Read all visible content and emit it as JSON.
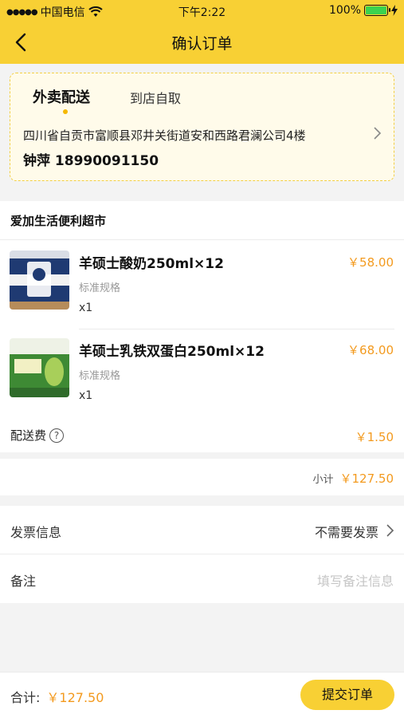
{
  "status_bar": {
    "carrier": "中国电信",
    "time": "下午2:22",
    "battery": "100%"
  },
  "nav": {
    "title": "确认订单"
  },
  "address": {
    "tab_active": "外卖配送",
    "tab_other": "到店自取",
    "text": "四川省自贡市富顺县邓井关街道安和西路君澜公司4楼",
    "person": "钟萍 18990091150"
  },
  "store": {
    "name": "爱加生活便利超市",
    "products": [
      {
        "name": "羊硕士酸奶250ml×12",
        "spec": "标准规格",
        "qty": "x1",
        "price": "￥58.00"
      },
      {
        "name": "羊硕士乳铁双蛋白250ml×12",
        "spec": "标准规格",
        "qty": "x1",
        "price": "￥68.00"
      }
    ],
    "delivery_fee_label": "配送费",
    "delivery_fee": "￥1.50"
  },
  "subtotal": {
    "label": "小计",
    "value": "￥127.50"
  },
  "invoice": {
    "label": "发票信息",
    "value": "不需要发票"
  },
  "remark": {
    "label": "备注",
    "placeholder": "填写备注信息"
  },
  "footer": {
    "total_label": "合计:",
    "total_value": "￥127.50",
    "submit_label": "提交订单"
  },
  "colors": {
    "brand": "#f8d034",
    "price": "#f39a1e"
  }
}
